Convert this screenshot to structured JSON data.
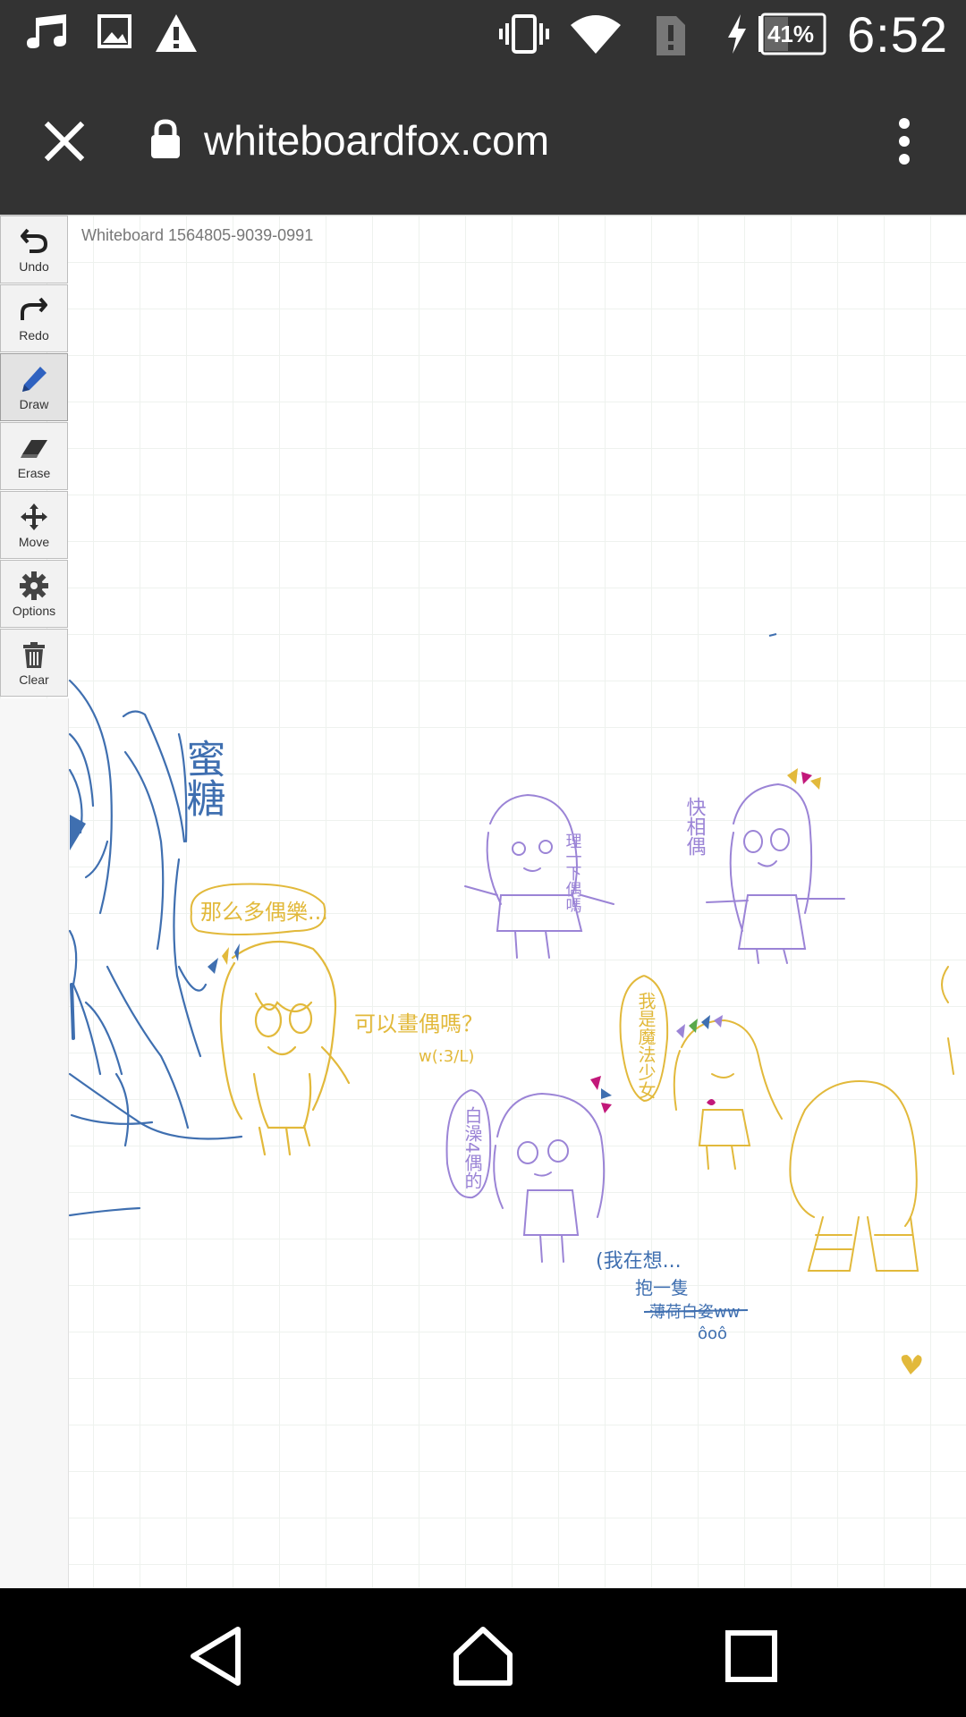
{
  "status_bar": {
    "time": "6:52",
    "battery_percent": "41%",
    "icons": [
      "music-note-icon",
      "image-icon",
      "warning-icon",
      "vibrate-icon",
      "wifi-icon",
      "sim-alert-icon",
      "charging-icon",
      "battery-icon"
    ]
  },
  "browser": {
    "url": "whiteboardfox.com",
    "close_icon": "close-icon",
    "lock_icon": "lock-icon",
    "menu_icon": "more-vert-icon"
  },
  "board": {
    "title": "Whiteboard 1564805-9039-0991"
  },
  "toolbar": {
    "tools": [
      {
        "label": "Undo",
        "icon": "undo-icon"
      },
      {
        "label": "Redo",
        "icon": "redo-icon"
      },
      {
        "label": "Draw",
        "icon": "pencil-icon",
        "active": true
      },
      {
        "label": "Erase",
        "icon": "eraser-icon"
      },
      {
        "label": "Move",
        "icon": "move-icon"
      },
      {
        "label": "Options",
        "icon": "gear-icon"
      },
      {
        "label": "Clear",
        "icon": "trash-icon"
      }
    ]
  },
  "drawing_text": {
    "honey_candy": "蜜糖",
    "bubble_1": "那么多偶樂...",
    "can_draw": "可以畫偶嗎？",
    "help_rent": "理一下偶嗎",
    "fast_idol": "快相偶",
    "magic_girl": "我是魔法少女",
    "white_haired": "白澡4偶的",
    "thinking": "(我在想...",
    "hug_one": "抱一隻",
    "crossed": "薄荷白姿ww",
    "dots": "ôoô",
    "emoticon": "w(:3/L)"
  },
  "colors": {
    "chrome": "#333333",
    "pen_blue": "#3f6fb0",
    "pen_yellow": "#e2b93b",
    "pen_purple": "#9b84d6"
  },
  "nav": {
    "back_icon": "back-triangle-icon",
    "home_icon": "home-icon",
    "recents_icon": "recents-square-icon"
  }
}
